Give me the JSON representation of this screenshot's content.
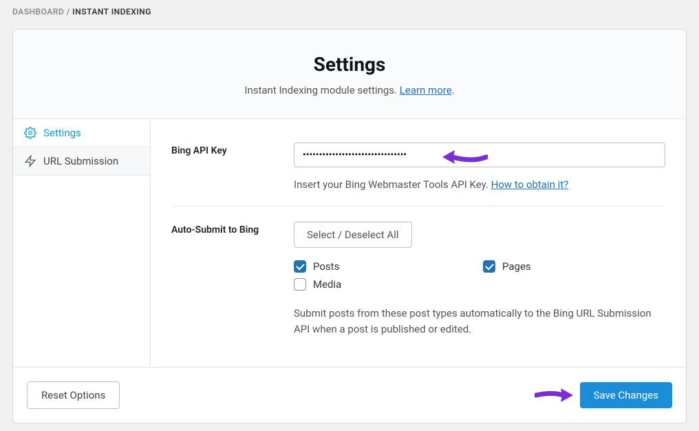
{
  "breadcrumb": {
    "root": "DASHBOARD",
    "sep": " / ",
    "current": "INSTANT INDEXING"
  },
  "header": {
    "title": "Settings",
    "subtitle_prefix": "Instant Indexing module settings. ",
    "learn_more": "Learn more",
    "subtitle_suffix": "."
  },
  "tabs": [
    {
      "id": "settings",
      "label": "Settings",
      "icon": "gear-icon",
      "active": true
    },
    {
      "id": "url-submission",
      "label": "URL Submission",
      "icon": "bolt-icon",
      "active": false
    }
  ],
  "apiKey": {
    "label": "Bing API Key",
    "value": "••••••••••••••••••••••••••••••••",
    "help_prefix": "Insert your Bing Webmaster Tools API Key. ",
    "help_link": "How to obtain it?"
  },
  "autoSubmit": {
    "label": "Auto-Submit to Bing",
    "selectAll": "Select / Deselect All",
    "options": [
      {
        "label": "Posts",
        "checked": true
      },
      {
        "label": "Pages",
        "checked": true
      },
      {
        "label": "Media",
        "checked": false
      }
    ],
    "description": "Submit posts from these post types automatically to the Bing URL Submission API when a post is published or edited."
  },
  "footer": {
    "reset": "Reset Options",
    "save": "Save Changes"
  }
}
